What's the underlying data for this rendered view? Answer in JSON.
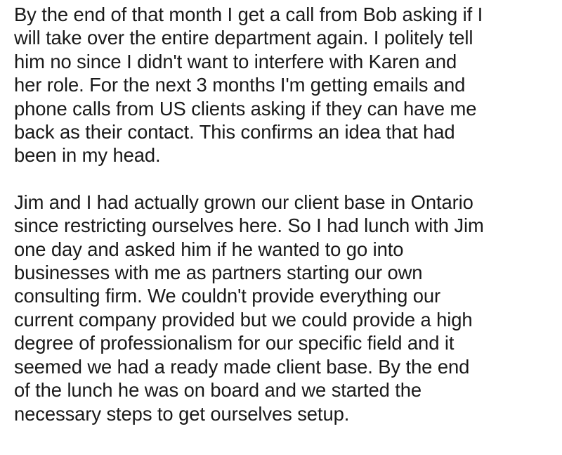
{
  "post": {
    "paragraphs": [
      {
        "lines": [
          "By the end of that month I get a call from Bob asking if I",
          "will take over the entire department again. I politely tell",
          "him no since I didn't want to interfere with Karen and",
          "her role.  For the next 3 months I'm getting emails and",
          "phone calls from US clients asking if they can have me",
          "back as their contact. This confirms an idea that had",
          "been in my head."
        ]
      },
      {
        "lines": [
          "Jim and I had actually grown our client base in Ontario",
          "since restricting ourselves here. So I had lunch with Jim",
          "one day and asked him if he wanted to go into",
          "businesses with me as partners starting our own",
          "consulting firm. We couldn't provide everything our",
          "current company provided but we could provide a high",
          "degree of professionalism for our specific field and it",
          "seemed we had a ready made client base. By the end",
          "of the lunch he was on board and we started the",
          "necessary steps to get ourselves setup."
        ]
      }
    ]
  }
}
